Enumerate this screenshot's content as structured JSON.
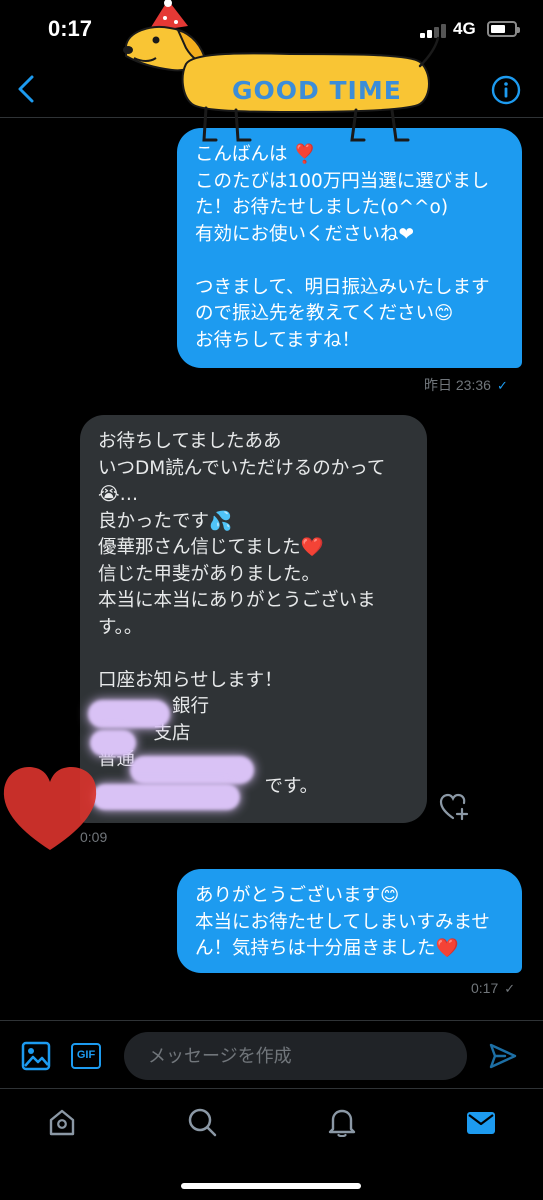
{
  "status_bar": {
    "time": "0:17",
    "network": "4G"
  },
  "header": {
    "back_icon": "chevron-left-icon",
    "info_icon": "info-icon"
  },
  "sticker": {
    "text": "GOOD TIME"
  },
  "messages": [
    {
      "direction": "sent",
      "text": "こんばんは ❣️\nこのたびは100万円当選に選びました！お待たせしました(o^^o)\n有効にお使いくださいね❤\n\nつきまして、明日振込みいたしますので振込先を教えてください😊\nお待ちしてますね！",
      "timestamp": "昨日 23:36",
      "status": "✓"
    },
    {
      "direction": "received",
      "text": "お待ちしてましたああ\nいつDM読んでいただけるのかって😭…\n良かったです💦\n優華那さん信じてました❤️\n信じた甲斐がありました。\n本当に本当にありがとうございます。。\n\n口座お知らせします！\n　　　　銀行\n　　　支店\n普通\n　　　　　　　　　です。",
      "timestamp": "0:09"
    },
    {
      "direction": "sent",
      "text": "ありがとうございます😊\n本当にお待たせしてしまいすみません！気持ちは十分届きました❤️",
      "timestamp": "0:17",
      "status": "✓"
    }
  ],
  "composer": {
    "placeholder": "メッセージを作成",
    "gif_label": "GIF"
  },
  "tabbar": {
    "items": [
      "home-icon",
      "search-icon",
      "notifications-icon",
      "messages-icon"
    ],
    "active": "messages-icon"
  },
  "colors": {
    "accent": "#1d9bf0",
    "sent_bubble": "#1d9bf0",
    "received_bubble": "#2f3336",
    "background": "#000000"
  }
}
